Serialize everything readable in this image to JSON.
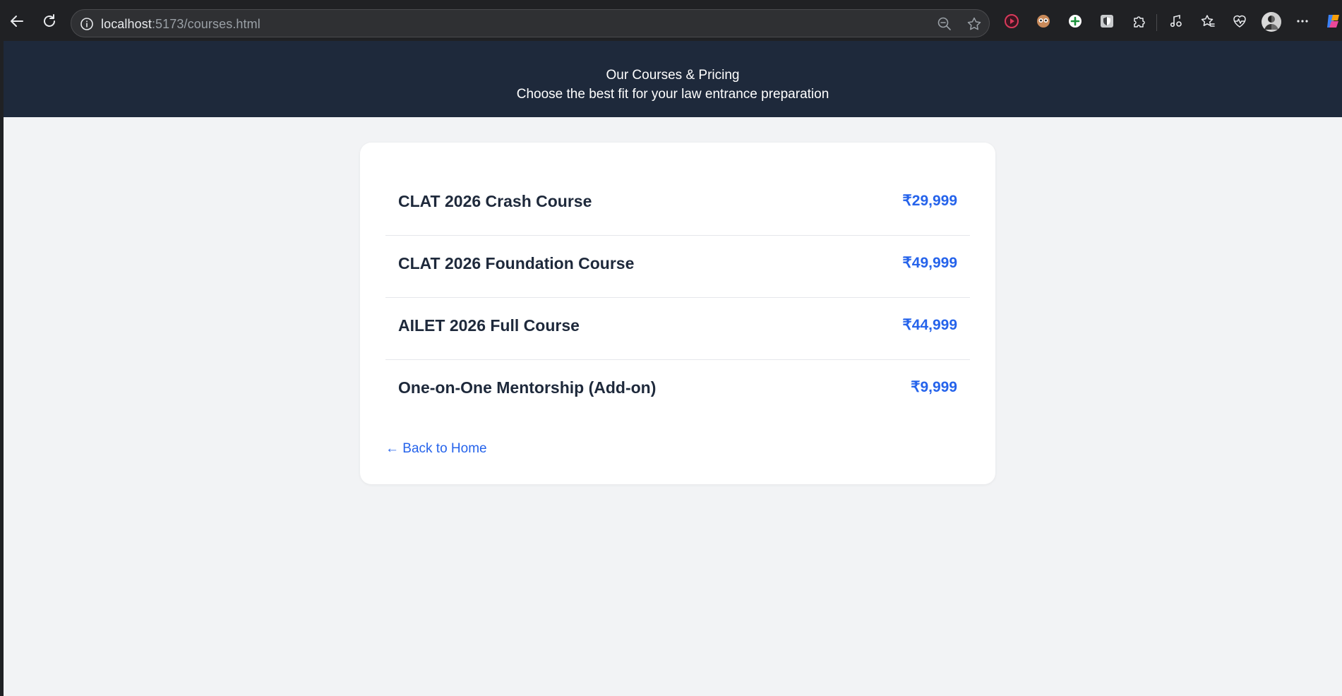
{
  "browser": {
    "url_host": "localhost",
    "url_path": ":5173/courses.html",
    "icons": [
      "back-arrow-icon",
      "reload-icon",
      "info-icon",
      "zoom-out-icon",
      "favorite-star-icon",
      "video-extension-icon",
      "owl-extension-icon",
      "add-extension-icon",
      "shield-extension-icon",
      "puzzle-extensions-icon",
      "media-control-icon",
      "favorites-icon",
      "health-icon",
      "profile-avatar",
      "more-menu-icon",
      "copilot-icon"
    ]
  },
  "hero": {
    "title": "Our Courses & Pricing",
    "subtitle": "Choose the best fit for your law entrance preparation"
  },
  "courses": [
    {
      "name": "CLAT 2026 Crash Course",
      "price": "₹29,999"
    },
    {
      "name": "CLAT 2026 Foundation Course",
      "price": "₹49,999"
    },
    {
      "name": "AILET 2026 Full Course",
      "price": "₹44,999"
    },
    {
      "name": "One-on-One Mentorship (Add-on)",
      "price": "₹9,999"
    }
  ],
  "back_link": "← Back to Home",
  "colors": {
    "hero_bg": "#1e293b",
    "page_bg": "#f2f3f5",
    "accent": "#2563eb",
    "text_dark": "#1e293b"
  }
}
